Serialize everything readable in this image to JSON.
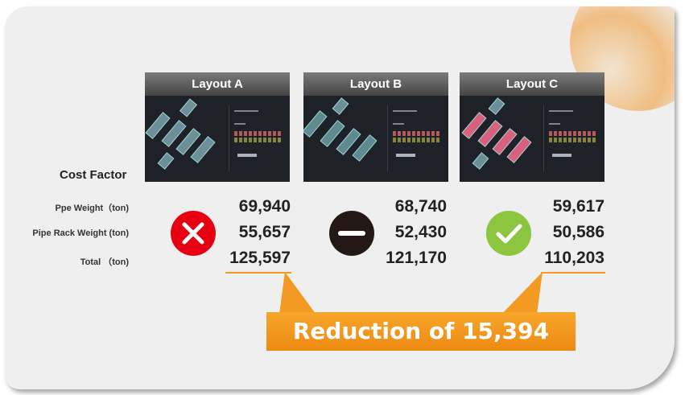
{
  "cost_factor_label": "Cost Factor",
  "row_labels": [
    "Ppe Weight（ton)",
    "Pipe Rack Weight (ton)",
    "Total （ton)"
  ],
  "layouts": [
    {
      "name": "Layout A",
      "status": "rejected",
      "status_icon": "x-circle-icon",
      "status_color": "#e60012",
      "pipe_weight": "69,940",
      "rack_weight": "55,657",
      "total": "125,597",
      "highlight_total": true
    },
    {
      "name": "Layout B",
      "status": "neutral",
      "status_icon": "minus-circle-icon",
      "status_color": "#231815",
      "pipe_weight": "68,740",
      "rack_weight": "52,430",
      "total": "121,170",
      "highlight_total": false
    },
    {
      "name": "Layout C",
      "status": "approved",
      "status_icon": "check-circle-icon",
      "status_color": "#8cc63f",
      "pipe_weight": "59,617",
      "rack_weight": "50,586",
      "total": "110,203",
      "highlight_total": true
    }
  ],
  "reduction_text": "Reduction of 15,394",
  "accent_color": "#f39a22"
}
